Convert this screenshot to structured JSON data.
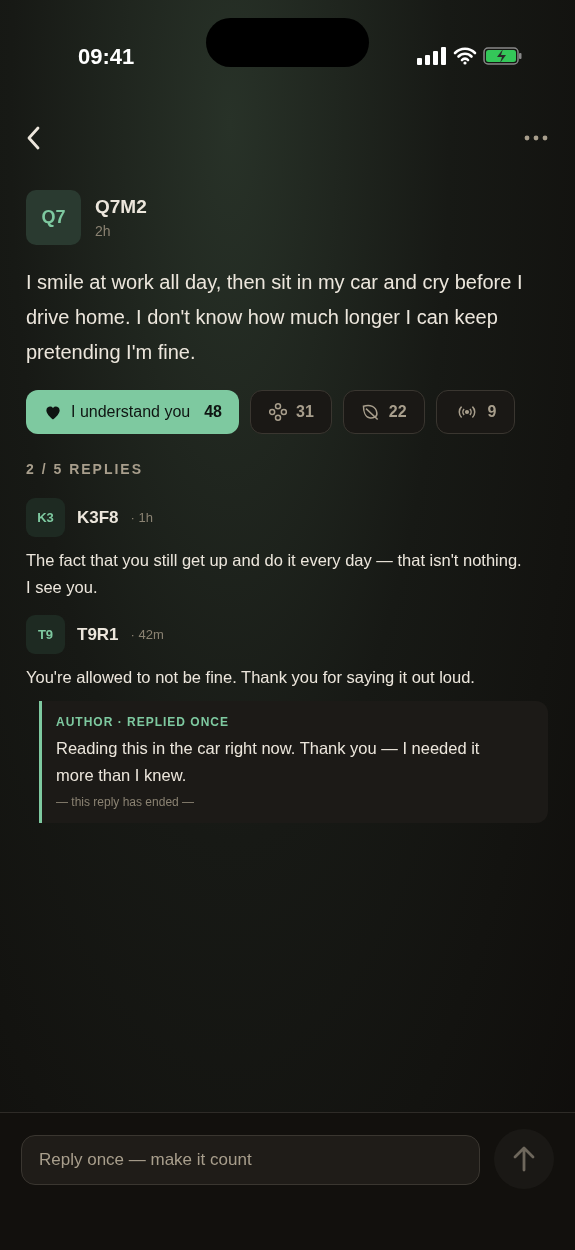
{
  "status_bar": {
    "time": "09:41"
  },
  "post": {
    "avatar": "Q7",
    "author": "Q7M2",
    "time": "2h",
    "body": "I smile at work all day, then sit in my car and cry before I drive home. I don't know how much longer I can keep pretending I'm fine."
  },
  "reactions": [
    {
      "kind": "heart",
      "label": "I understand you",
      "count": "48",
      "selected": true
    },
    {
      "kind": "flower",
      "count": "31",
      "selected": false
    },
    {
      "kind": "leaf",
      "count": "22",
      "selected": false
    },
    {
      "kind": "signal",
      "count": "9",
      "selected": false
    }
  ],
  "replies_label": "2 / 5 REPLIES",
  "replies": [
    {
      "avatar": "K3",
      "author": "K3F8",
      "time": "· 1h",
      "body": "The fact that you still get up and do it every day — that isn't nothing. I see you."
    },
    {
      "avatar": "T9",
      "author": "T9R1",
      "time": "· 42m",
      "body": "You're allowed to not be fine. Thank you for saying it out loud.",
      "author_reply": {
        "label": "AUTHOR · REPLIED ONCE",
        "body": "Reading this in the car right now. Thank you — I needed it more than I knew.",
        "footer": "— this reply has ended —"
      }
    }
  ],
  "composer": {
    "placeholder": "Reply once — make it count"
  }
}
